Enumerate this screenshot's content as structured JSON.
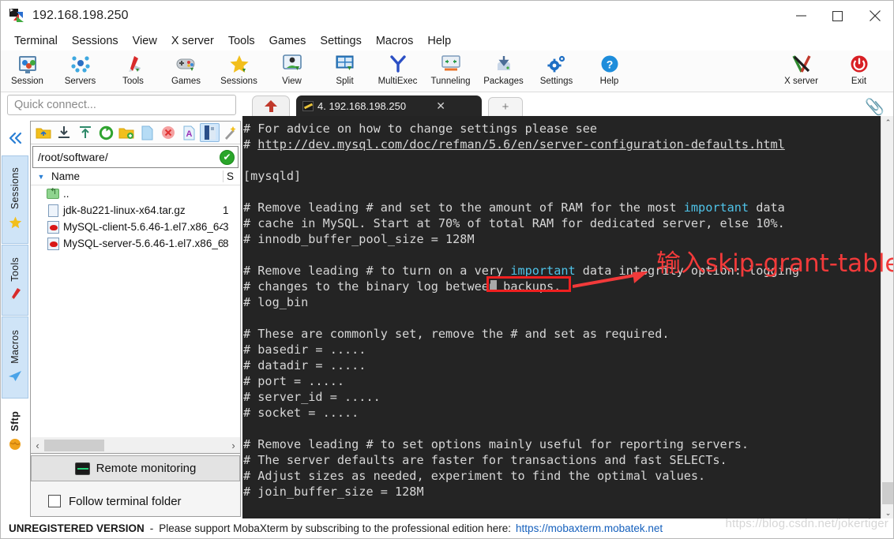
{
  "window": {
    "title": "192.168.198.250",
    "icon": "mobaxterm-icon",
    "minimize_label": "—",
    "maximize_label": "□",
    "close_label": "✕"
  },
  "menu": {
    "items": [
      {
        "label": "Terminal"
      },
      {
        "label": "Sessions"
      },
      {
        "label": "View"
      },
      {
        "label": "X server"
      },
      {
        "label": "Tools"
      },
      {
        "label": "Games"
      },
      {
        "label": "Settings"
      },
      {
        "label": "Macros"
      },
      {
        "label": "Help"
      }
    ]
  },
  "toolbar": {
    "left_buttons": [
      {
        "label": "Session",
        "icon": "session-icon"
      },
      {
        "label": "Servers",
        "icon": "servers-icon"
      },
      {
        "label": "Tools",
        "icon": "tools-icon"
      },
      {
        "label": "Games",
        "icon": "games-icon"
      },
      {
        "label": "Sessions",
        "icon": "star-icon"
      },
      {
        "label": "View",
        "icon": "view-icon"
      },
      {
        "label": "Split",
        "icon": "split-icon"
      },
      {
        "label": "MultiExec",
        "icon": "multiexec-icon"
      },
      {
        "label": "Tunneling",
        "icon": "tunneling-icon"
      },
      {
        "label": "Packages",
        "icon": "packages-icon"
      },
      {
        "label": "Settings",
        "icon": "settings-gear-icon"
      },
      {
        "label": "Help",
        "icon": "help-question-icon"
      }
    ],
    "right_buttons": [
      {
        "label": "X server",
        "icon": "xserver-icon"
      },
      {
        "label": "Exit",
        "icon": "power-exit-icon"
      }
    ]
  },
  "quick_connect": {
    "placeholder": "Quick connect..."
  },
  "rail": {
    "collapse_icon": "double-chevron-left-icon",
    "tabs": [
      {
        "label": "Sessions",
        "icon": "star-icon",
        "active": false
      },
      {
        "label": "Tools",
        "icon": "swiss-knife-icon",
        "active": false
      },
      {
        "label": "Macros",
        "icon": "paper-plane-icon",
        "active": false
      },
      {
        "label": "Sftp",
        "icon": "globe-icon",
        "active": true
      }
    ]
  },
  "sftp": {
    "toolbar_icons": [
      {
        "name": "go-up-folder-icon",
        "selected": false
      },
      {
        "name": "download-icon",
        "selected": false
      },
      {
        "name": "upload-icon",
        "selected": false
      },
      {
        "name": "refresh-icon",
        "selected": false
      },
      {
        "name": "new-folder-icon",
        "selected": false
      },
      {
        "name": "new-file-icon",
        "selected": false
      },
      {
        "name": "delete-icon",
        "selected": false
      },
      {
        "name": "text-mode-icon",
        "selected": false
      },
      {
        "name": "binary-mode-icon",
        "selected": true
      },
      {
        "name": "magic-wand-icon",
        "selected": false
      }
    ],
    "path": "/root/software/",
    "path_status_icon": "check-ok-icon",
    "columns": [
      "Name",
      "S"
    ],
    "rows": [
      {
        "icon": "parent-folder-icon",
        "name": "..",
        "size": ""
      },
      {
        "icon": "archive-file-icon",
        "name": "jdk-8u221-linux-x64.tar.gz",
        "size": "1"
      },
      {
        "icon": "rpm-file-icon",
        "name": "MySQL-client-5.6.46-1.el7.x86_64...",
        "size": "3"
      },
      {
        "icon": "rpm-file-icon",
        "name": "MySQL-server-5.6.46-1.el7.x86_6...",
        "size": "8"
      }
    ],
    "hscroll": {
      "left_arrow": "‹",
      "right_arrow": "›"
    },
    "remote_monitoring_label": "Remote monitoring",
    "follow_terminal_folder_label": "Follow terminal folder",
    "follow_terminal_folder_checked": false
  },
  "tabs": {
    "home_icon": "home-icon",
    "session": {
      "label": "4. 192.168.198.250",
      "icon": "ssh-session-icon",
      "close_label": "✕"
    },
    "new_tab_label": "+",
    "clip_icon": "paperclip-icon"
  },
  "terminal": {
    "lines": [
      {
        "segments": [
          {
            "t": "# For advice on how to change settings please see"
          }
        ]
      },
      {
        "segments": [
          {
            "t": "# "
          },
          {
            "t": "http://dev.mysql.com/doc/refman/5.6/en/server-configuration-defaults.html",
            "c": "link"
          }
        ]
      },
      {
        "segments": [
          {
            "t": ""
          }
        ]
      },
      {
        "segments": [
          {
            "t": "[mysqld]"
          }
        ]
      },
      {
        "segments": [
          {
            "t": ""
          }
        ]
      },
      {
        "segments": [
          {
            "t": "# Remove leading # and set to the amount of RAM for the most "
          },
          {
            "t": "important",
            "c": "cy"
          },
          {
            "t": " data"
          }
        ]
      },
      {
        "segments": [
          {
            "t": "# cache in MySQL. Start at 70% of total RAM for dedicated server, else 10%."
          }
        ]
      },
      {
        "segments": [
          {
            "t": "# innodb_buffer_pool_size = 128M"
          }
        ]
      },
      {
        "segments": [
          {
            "t": ""
          }
        ]
      },
      {
        "segments": [
          {
            "t": "# Remove leading # to turn on a very "
          },
          {
            "t": "important",
            "c": "cy"
          },
          {
            "t": " data integrity option: logging"
          }
        ]
      },
      {
        "segments": [
          {
            "t": "# changes to the binary log between backups."
          }
        ]
      },
      {
        "segments": [
          {
            "t": "# log_bin"
          }
        ]
      },
      {
        "segments": [
          {
            "t": ""
          }
        ]
      },
      {
        "segments": [
          {
            "t": "# These are commonly set, remove the # and set as required."
          }
        ]
      },
      {
        "segments": [
          {
            "t": "# basedir = ....."
          }
        ]
      },
      {
        "segments": [
          {
            "t": "# datadir = ....."
          }
        ]
      },
      {
        "segments": [
          {
            "t": "# port = ....."
          }
        ]
      },
      {
        "segments": [
          {
            "t": "# server_id = ....."
          }
        ]
      },
      {
        "segments": [
          {
            "t": "# socket = ....."
          }
        ]
      },
      {
        "segments": [
          {
            "t": ""
          }
        ]
      },
      {
        "segments": [
          {
            "t": "# Remove leading # to set options mainly useful for reporting servers."
          }
        ]
      },
      {
        "segments": [
          {
            "t": "# The server defaults are faster for transactions and fast SELECTs."
          }
        ]
      },
      {
        "segments": [
          {
            "t": "# Adjust sizes as needed, experiment to find the optimal values."
          }
        ]
      },
      {
        "segments": [
          {
            "t": "# join_buffer_size = 128M"
          }
        ]
      }
    ],
    "scrollbar": {
      "up_arrow": "⌃",
      "down_arrow": "⌄"
    }
  },
  "annotation": {
    "text": "输入skip-grant-tables",
    "color": "#f23a3a",
    "box_note": "empty input line highlighted"
  },
  "statusbar": {
    "unregistered": "UNREGISTERED VERSION",
    "dash": "-",
    "message": "Please support MobaXterm by subscribing to the professional edition here:",
    "link": "https://mobaxterm.mobatek.net"
  },
  "watermark": {
    "text": "https://blog.csdn.net/jokertiger"
  },
  "colors": {
    "accent": "#1f66b5",
    "terminal_bg": "#242424",
    "terminal_fg": "#d6d6d6",
    "cyan": "#4fc3e8",
    "annotation_red": "#f23a3a",
    "ok_green": "#2aa52a"
  }
}
